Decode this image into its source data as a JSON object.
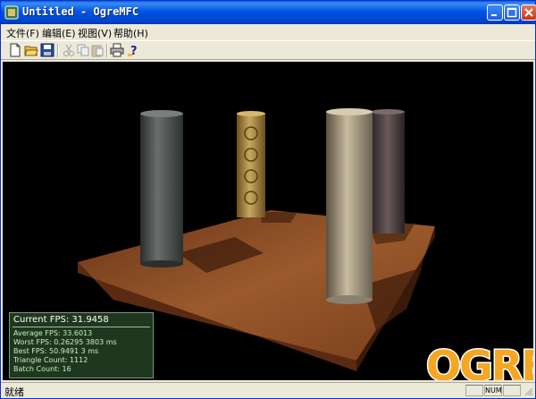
{
  "window": {
    "title": "Untitled - OgreMFC",
    "icons": {
      "app": "ogre-app-icon",
      "minimize": "minimize-icon",
      "maximize": "maximize-icon",
      "close": "close-icon"
    }
  },
  "menu": {
    "file": "文件(F)",
    "edit": "编辑(E)",
    "view": "视图(V)",
    "help": "帮助(H)"
  },
  "toolbar": {
    "icons": [
      "new-file-icon",
      "open-folder-icon",
      "save-icon",
      "cut-icon",
      "copy-icon",
      "paste-icon",
      "print-icon",
      "help-about-icon"
    ]
  },
  "overlay": {
    "current_fps": "Current FPS: 31.9458",
    "average_fps": "Average FPS: 33.6013",
    "worst_fps": "Worst FPS: 0.26295 3803 ms",
    "best_fps": "Best FPS: 50.9491 3 ms",
    "triangle_count": "Triangle Count: 1112",
    "batch_count": "Batch Count: 16"
  },
  "logo": {
    "text": "OGRE",
    "colors": {
      "fill": "#f5a623",
      "outline": "#ffffff"
    }
  },
  "status": {
    "text": "就绪",
    "num": "NUM"
  },
  "colors": {
    "title_bar": "#0055e5",
    "viewport_bg": "#000000",
    "overlay_bg": "#223c22",
    "floor": "#8a4a24"
  }
}
